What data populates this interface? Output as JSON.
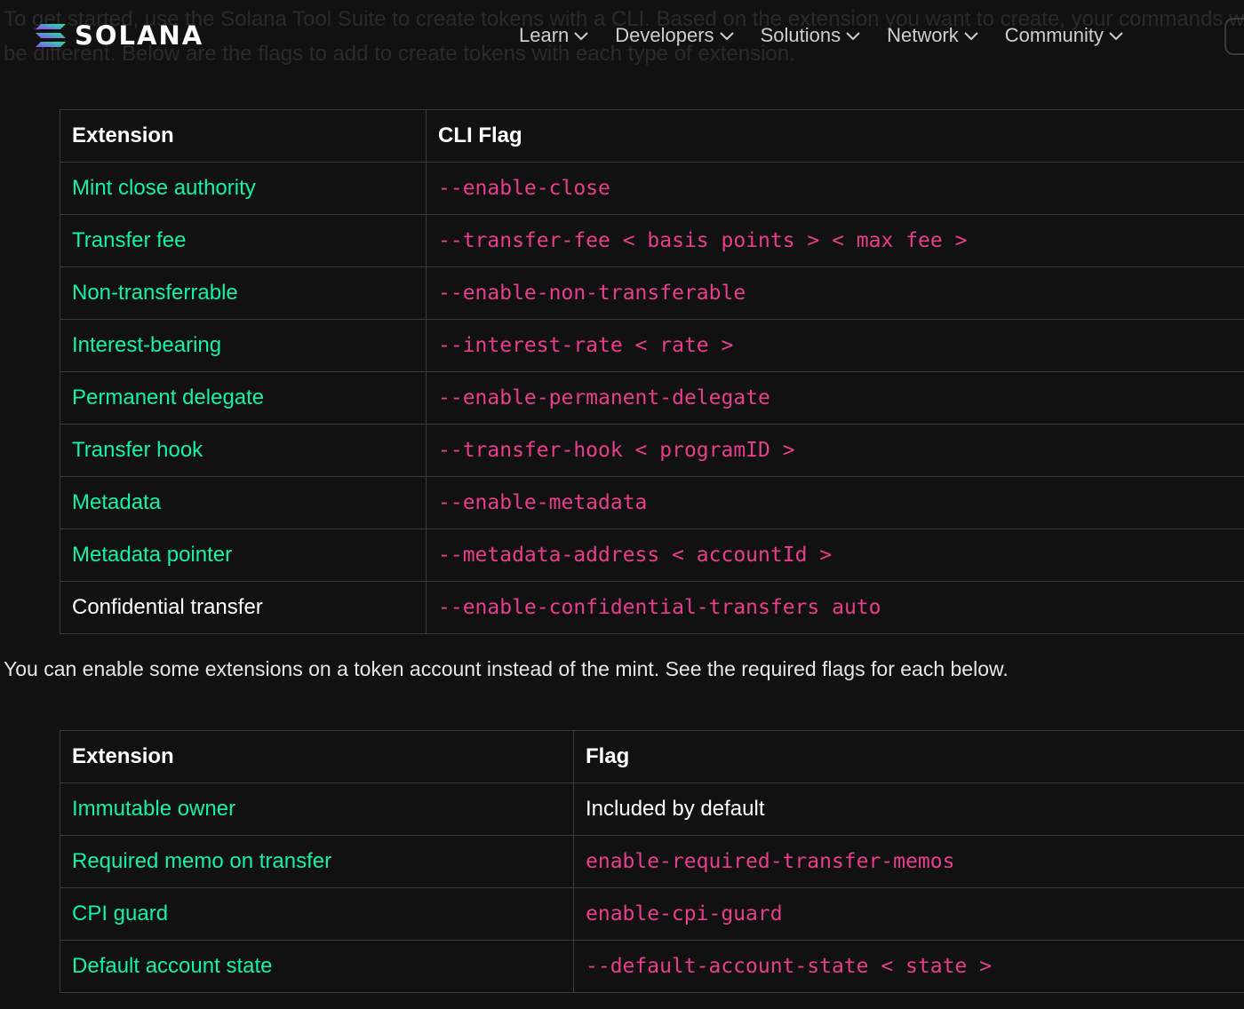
{
  "background_text": {
    "line1": "To get started, use the Solana Tool Suite to create tokens with a CLI. Based on the extension you want to create, your commands will",
    "line2": "be different. Below are the flags to add to create tokens with each type of extension."
  },
  "header": {
    "logo_text": "SOLANA",
    "nav": [
      {
        "label": "Learn"
      },
      {
        "label": "Developers"
      },
      {
        "label": "Solutions"
      },
      {
        "label": "Network"
      },
      {
        "label": "Community"
      }
    ]
  },
  "mint_table": {
    "headers": [
      "Extension",
      "CLI Flag"
    ],
    "rows": [
      {
        "extension": "Mint close authority",
        "flag": "--enable-close"
      },
      {
        "extension": "Transfer fee",
        "flag": "--transfer-fee < basis points > < max fee >"
      },
      {
        "extension": "Non-transferrable",
        "flag": "--enable-non-transferable"
      },
      {
        "extension": "Interest-bearing",
        "flag": "--interest-rate < rate >"
      },
      {
        "extension": "Permanent delegate",
        "flag": "--enable-permanent-delegate"
      },
      {
        "extension": "Transfer hook",
        "flag": "--transfer-hook < programID >"
      },
      {
        "extension": "Metadata",
        "flag": "--enable-metadata"
      },
      {
        "extension": "Metadata pointer",
        "flag": "--metadata-address < accountId >"
      },
      {
        "extension": "Confidential transfer",
        "flag": "--enable-confidential-transfers auto"
      }
    ]
  },
  "account_paragraph": "You can enable some extensions on a token account instead of the mint. See the required flags for each below.",
  "account_table": {
    "headers": [
      "Extension",
      "Flag"
    ],
    "rows": [
      {
        "extension": "Immutable owner",
        "flag": "Included by default"
      },
      {
        "extension": "Required memo on transfer",
        "flag": "enable-required-transfer-memos"
      },
      {
        "extension": "CPI guard",
        "flag": "enable-cpi-guard"
      },
      {
        "extension": "Default account state",
        "flag": "--default-account-state < state >"
      }
    ]
  },
  "colors": {
    "background": "#111111",
    "link_green": "#14f1a8",
    "code_pink": "#e83e8c",
    "border": "#3a3a3a"
  }
}
